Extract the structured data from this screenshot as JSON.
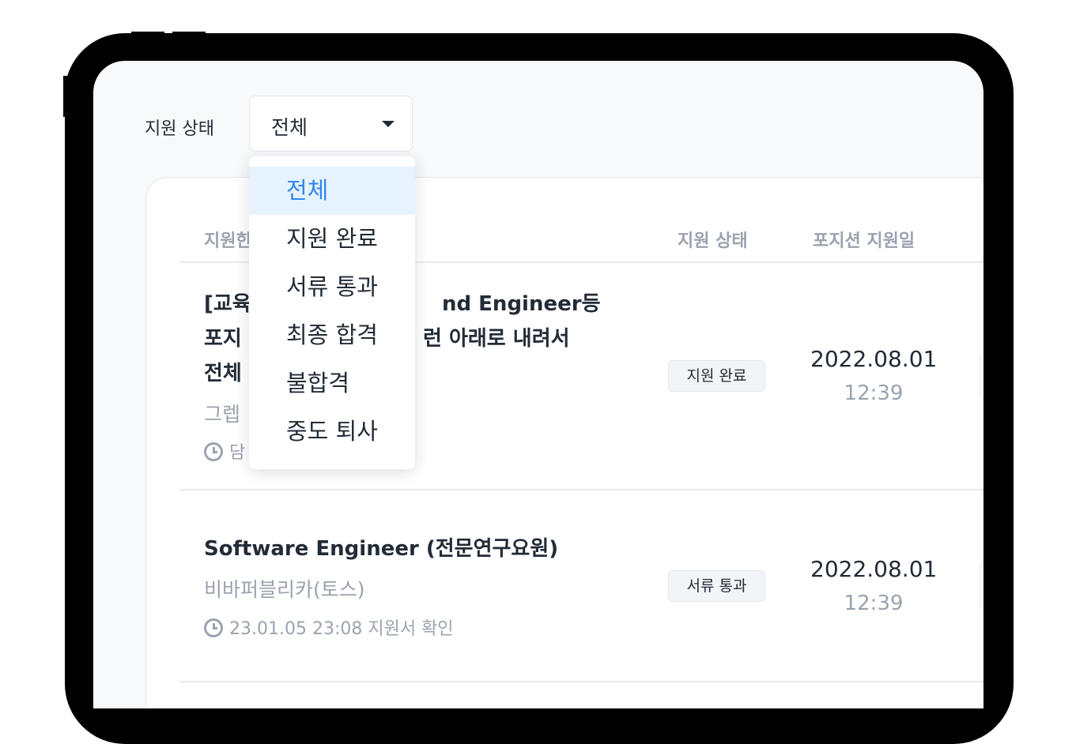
{
  "filter": {
    "label": "지원 상태",
    "selected": "전체",
    "options": [
      "전체",
      "지원 완료",
      "서류 통과",
      "최종 합격",
      "불합격",
      "중도 퇴사"
    ]
  },
  "table": {
    "headers": {
      "position": "지원한",
      "status": "지원 상태",
      "date": "포지션 지원일"
    },
    "rows": [
      {
        "title_lines": [
          "[교육",
          "nd Engineer등",
          "포지",
          "런 아래로 내려서",
          "전체"
        ],
        "company": "그렙",
        "meta": "담",
        "status": "지원 완료",
        "date": "2022.08.01",
        "time": "12:39"
      },
      {
        "title": "Software Engineer (전문연구요원)",
        "company": "비바퍼블리카(토스)",
        "meta": "23.01.05 23:08 지원서 확인",
        "status": "서류 통과",
        "date": "2022.08.01",
        "time": "12:39"
      }
    ]
  },
  "colors": {
    "accent": "#2f86f0",
    "selected_bg": "#e6f2fd",
    "text": "#222b36",
    "muted": "#9aa3ae"
  },
  "icons": [
    "chevron-down-icon",
    "clock-icon"
  ]
}
